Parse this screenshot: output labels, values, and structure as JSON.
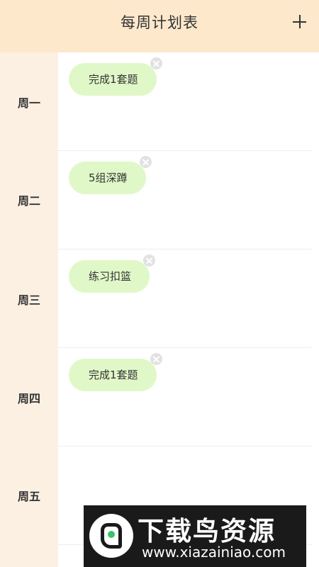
{
  "header": {
    "title": "每周计划表",
    "add_icon": "plus-icon"
  },
  "days": [
    {
      "label": "周一",
      "tasks": [
        "完成1套题"
      ]
    },
    {
      "label": "周二",
      "tasks": [
        "5组深蹲"
      ]
    },
    {
      "label": "周三",
      "tasks": [
        "练习扣篮"
      ]
    },
    {
      "label": "周四",
      "tasks": [
        "完成1套题"
      ]
    },
    {
      "label": "周五",
      "tasks": []
    }
  ],
  "watermark": {
    "title": "下载鸟资源",
    "url": "www.xiazainiao.com"
  },
  "colors": {
    "header_bg": "#fde8cc",
    "day_column_bg": "#fcf0e3",
    "task_bg": "#e0f8c8",
    "text": "#333333",
    "close_icon": "#e2e2e2"
  }
}
